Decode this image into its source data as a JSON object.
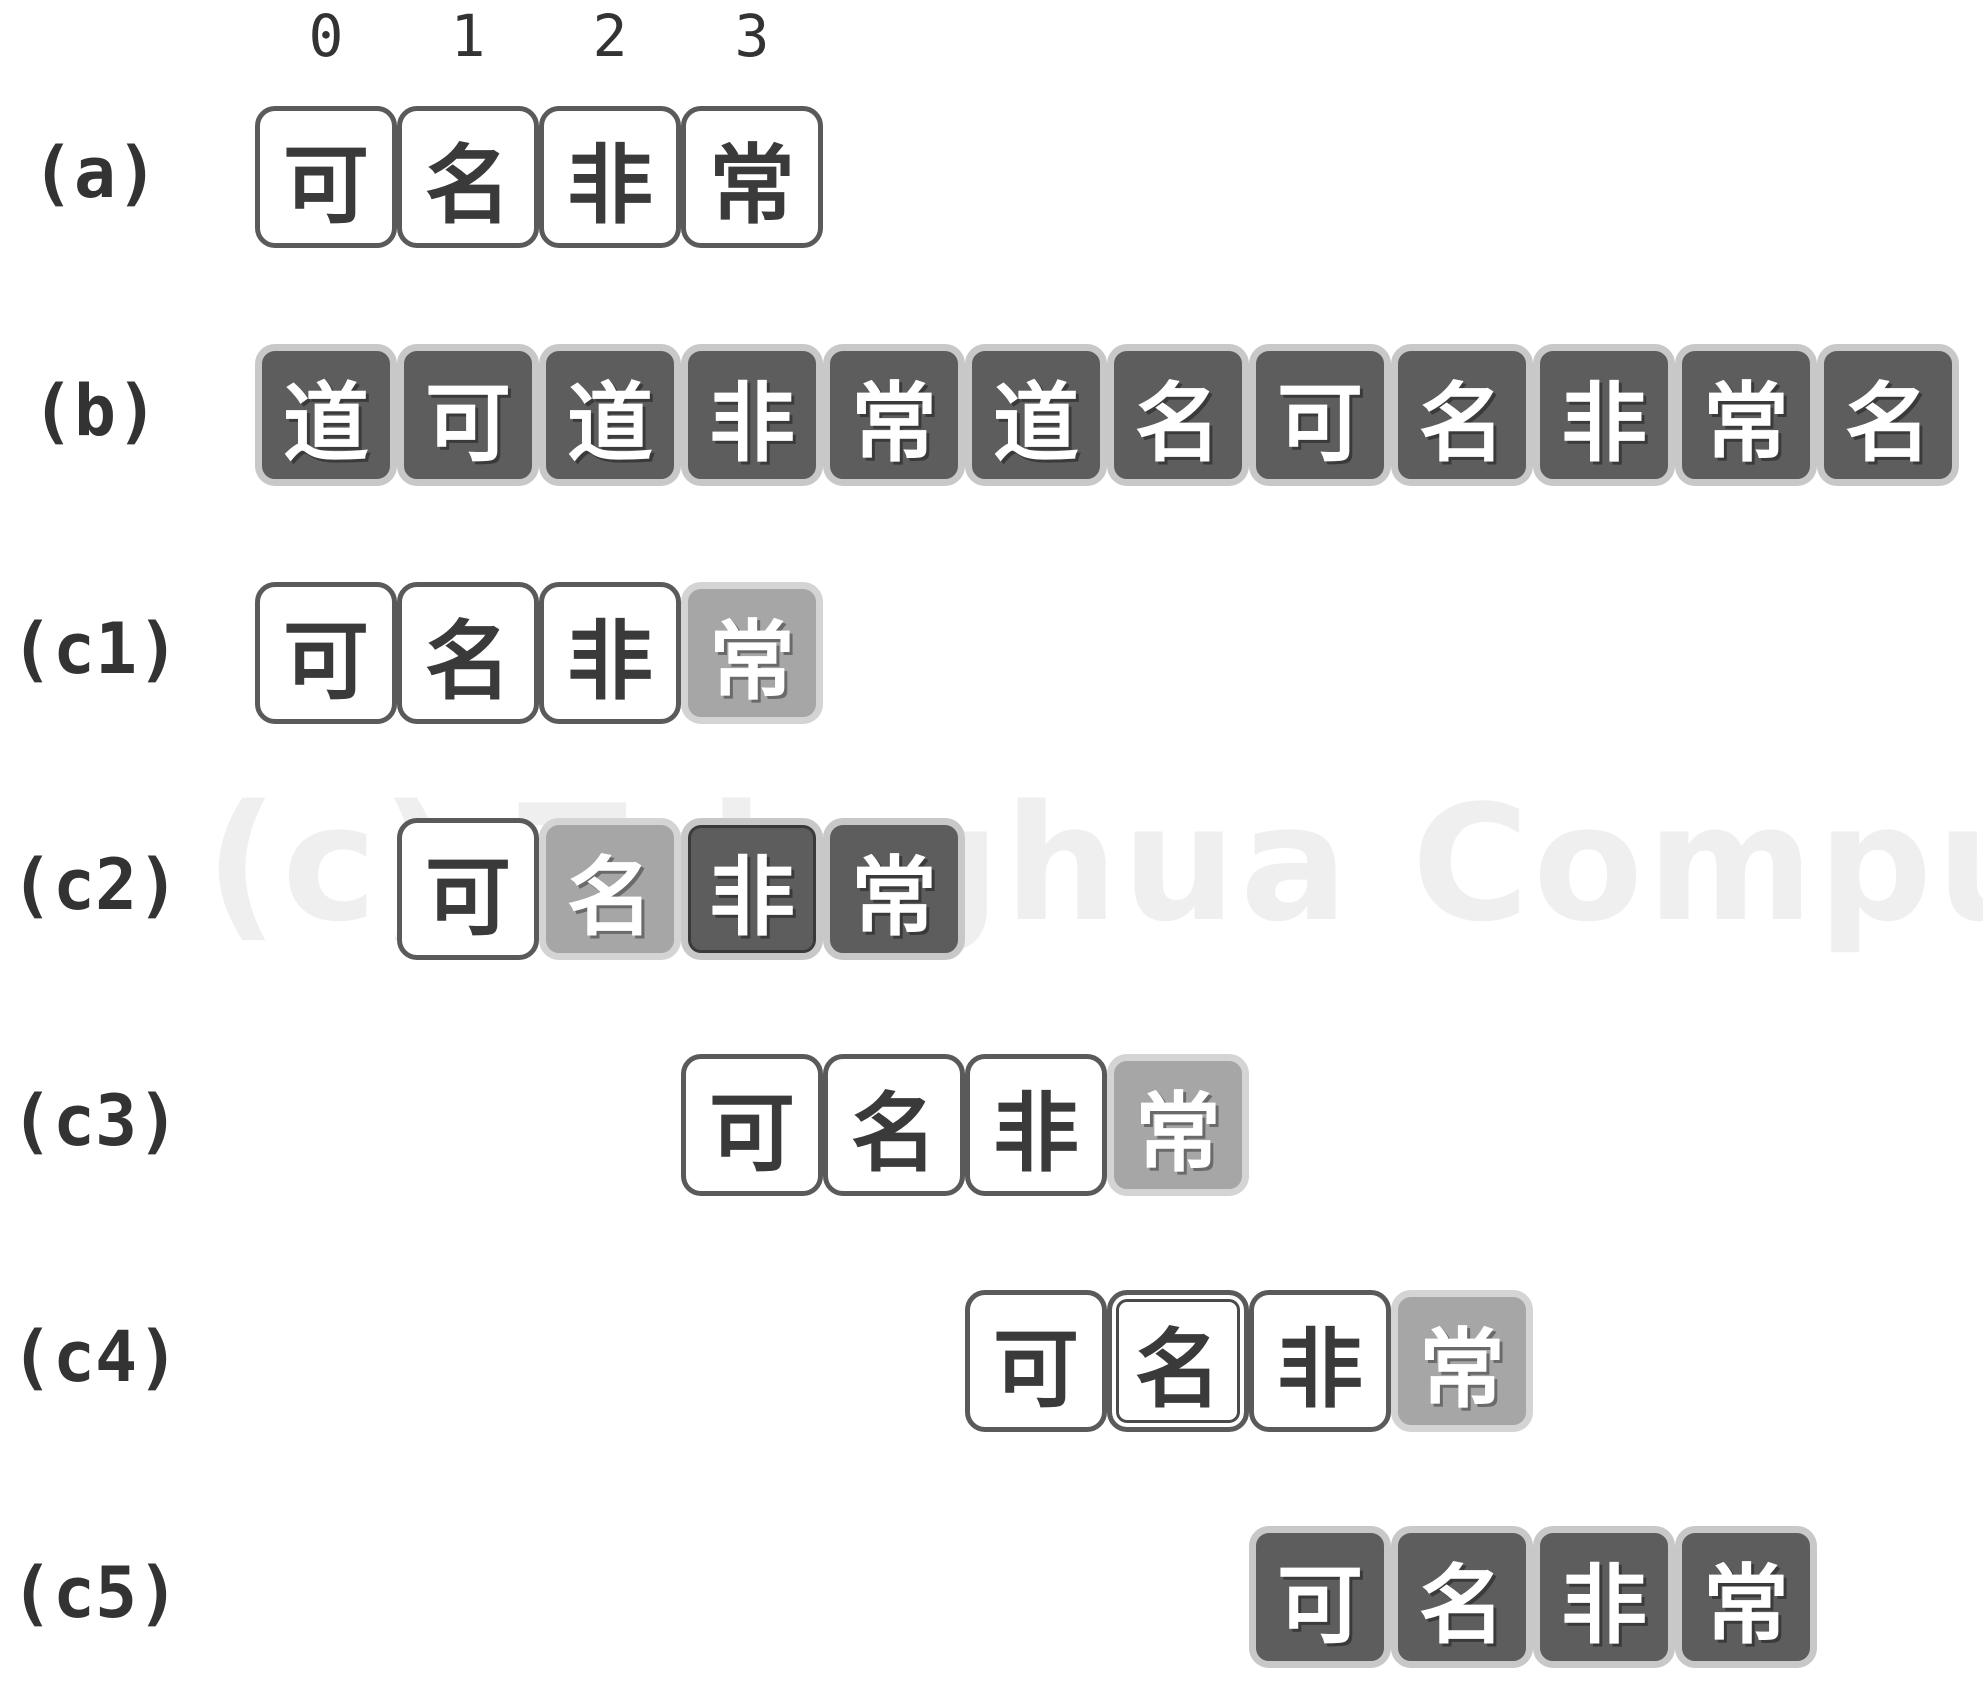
{
  "watermark": "(c) Tsinghua Computer",
  "index_labels": [
    "0",
    "1",
    "2",
    "3"
  ],
  "rows": [
    {
      "label": "(a)",
      "cells": [
        {
          "char": "可",
          "style": "white"
        },
        {
          "char": "名",
          "style": "white"
        },
        {
          "char": "非",
          "style": "white"
        },
        {
          "char": "常",
          "style": "white"
        }
      ]
    },
    {
      "label": "(b)",
      "cells": [
        {
          "char": "道",
          "style": "dark"
        },
        {
          "char": "可",
          "style": "dark"
        },
        {
          "char": "道",
          "style": "dark"
        },
        {
          "char": "非",
          "style": "dark"
        },
        {
          "char": "常",
          "style": "dark"
        },
        {
          "char": "道",
          "style": "dark"
        },
        {
          "char": "名",
          "style": "dark"
        },
        {
          "char": "可",
          "style": "dark"
        },
        {
          "char": "名",
          "style": "dark"
        },
        {
          "char": "非",
          "style": "dark"
        },
        {
          "char": "常",
          "style": "dark"
        },
        {
          "char": "名",
          "style": "dark"
        }
      ]
    },
    {
      "label": "(c1)",
      "cells": [
        {
          "char": "可",
          "style": "white"
        },
        {
          "char": "名",
          "style": "white"
        },
        {
          "char": "非",
          "style": "white"
        },
        {
          "char": "常",
          "style": "light"
        }
      ]
    },
    {
      "label": "(c2)",
      "cells": [
        {
          "char": "可",
          "style": "white"
        },
        {
          "char": "名",
          "style": "light"
        },
        {
          "char": "非",
          "style": "dark",
          "double": true
        },
        {
          "char": "常",
          "style": "dark"
        }
      ]
    },
    {
      "label": "(c3)",
      "cells": [
        {
          "char": "可",
          "style": "white"
        },
        {
          "char": "名",
          "style": "white"
        },
        {
          "char": "非",
          "style": "white"
        },
        {
          "char": "常",
          "style": "light"
        }
      ]
    },
    {
      "label": "(c4)",
      "cells": [
        {
          "char": "可",
          "style": "white"
        },
        {
          "char": "名",
          "style": "white",
          "double": true
        },
        {
          "char": "非",
          "style": "white"
        },
        {
          "char": "常",
          "style": "light"
        }
      ]
    },
    {
      "label": "(c5)",
      "cells": [
        {
          "char": "可",
          "style": "dark"
        },
        {
          "char": "名",
          "style": "dark"
        },
        {
          "char": "非",
          "style": "dark"
        },
        {
          "char": "常",
          "style": "dark"
        }
      ]
    }
  ]
}
